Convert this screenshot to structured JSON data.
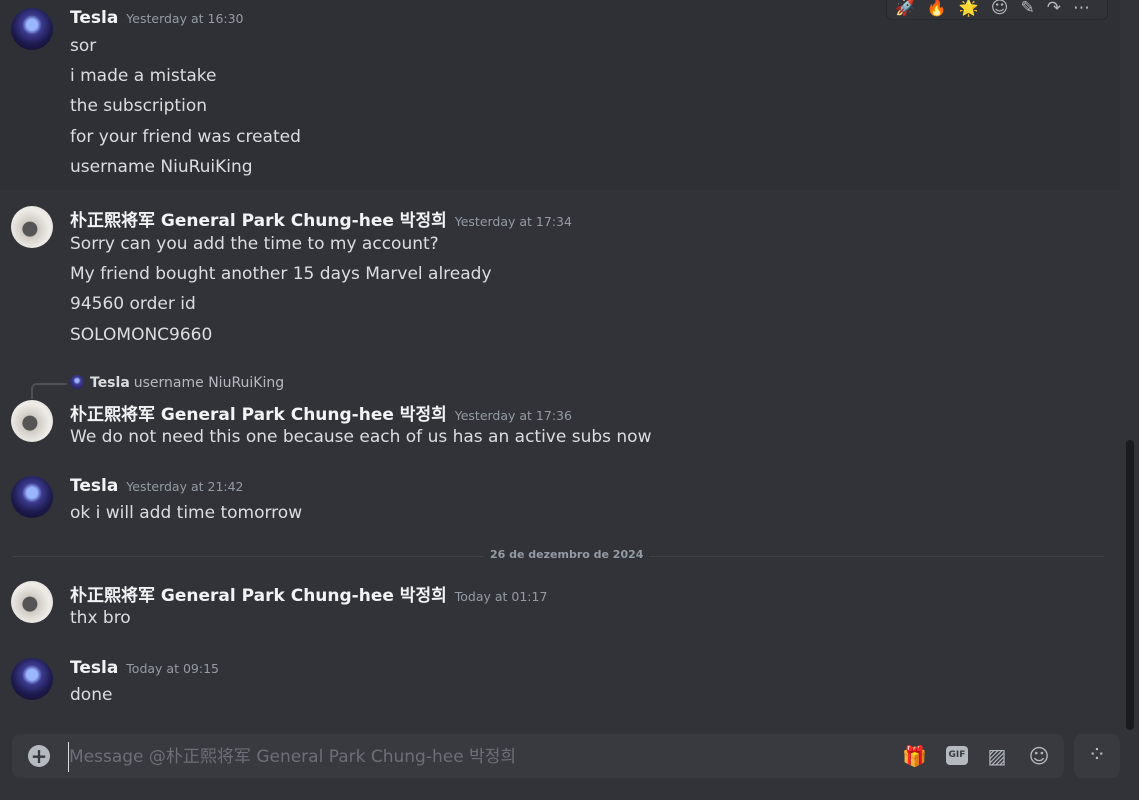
{
  "toolbar": {
    "reactions": [
      "🚀",
      "🔥",
      "🌟"
    ],
    "icons": [
      "add-reaction-icon",
      "edit-icon",
      "forward-icon",
      "more-icon"
    ]
  },
  "messages": [
    {
      "author": "Tesla",
      "timestamp": "Yesterday at 16:30",
      "lines": [
        "sor",
        "i made a mistake",
        "the subscription",
        "for your friend was created",
        "username NiuRuiKing"
      ]
    },
    {
      "author": "朴正熙将军 General Park Chung-hee 박정희",
      "timestamp": "Yesterday at 17:34",
      "lines": [
        "Sorry can you add the time to my account?",
        "My friend bought another 15 days Marvel already",
        "94560 order id",
        "SOLOMONC9660"
      ]
    },
    {
      "reply": {
        "author": "Tesla",
        "text": "username NiuRuiKing"
      },
      "author": "朴正熙将军 General Park Chung-hee 박정희",
      "timestamp": "Yesterday at 17:36",
      "lines": [
        "We do not need this one because each of us has an active subs now"
      ]
    },
    {
      "author": "Tesla",
      "timestamp": "Yesterday at 21:42",
      "lines": [
        "ok i will add time tomorrow"
      ]
    },
    {
      "author": "朴正熙将军 General Park Chung-hee 박정희",
      "timestamp": "Today at 01:17",
      "lines": [
        "thx bro"
      ]
    },
    {
      "author": "Tesla",
      "timestamp": "Today at 09:15",
      "lines": [
        "done"
      ]
    }
  ],
  "date_divider": "26 de dezembro de 2024",
  "composer": {
    "placeholder": "Message @朴正熙将军 General Park Chung-hee 박정희",
    "gif_label": "GIF"
  }
}
